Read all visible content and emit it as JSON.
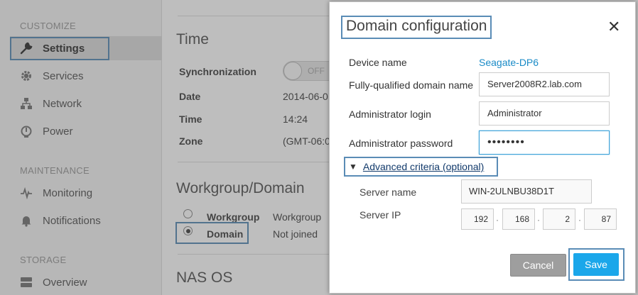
{
  "sidebar": {
    "sections": [
      {
        "title": "CUSTOMIZE"
      },
      {
        "title": "MAINTENANCE"
      },
      {
        "title": "STORAGE"
      }
    ],
    "items": [
      {
        "label": "Settings",
        "icon": "wrench-icon",
        "active": true
      },
      {
        "label": "Services",
        "icon": "gear-icon"
      },
      {
        "label": "Network",
        "icon": "network-icon"
      },
      {
        "label": "Power",
        "icon": "power-icon"
      },
      {
        "label": "Monitoring",
        "icon": "pulse-icon"
      },
      {
        "label": "Notifications",
        "icon": "bell-icon"
      },
      {
        "label": "Overview",
        "icon": "storage-icon"
      }
    ]
  },
  "main": {
    "time": {
      "title": "Time",
      "sync_label": "Synchronization",
      "sync_toggle": "OFF",
      "date_label": "Date",
      "date_value": "2014-06-0",
      "time_label": "Time",
      "time_value": "14:24",
      "zone_label": "Zone",
      "zone_value": "(GMT-06:0"
    },
    "workgroup": {
      "title": "Workgroup/Domain",
      "options": [
        {
          "label": "Workgroup",
          "value": "Workgroup",
          "selected": false
        },
        {
          "label": "Domain",
          "value": "Not joined",
          "selected": true
        }
      ]
    },
    "nas_title": "NAS OS"
  },
  "modal": {
    "title": "Domain configuration",
    "close": "✕",
    "device_name_label": "Device name",
    "device_name_value": "Seagate-DP6",
    "fqdn_label": "Fully-qualified domain name",
    "fqdn_value": "Server2008R2.lab.com",
    "admin_login_label": "Administrator login",
    "admin_login_value": "Administrator",
    "admin_password_label": "Administrator password",
    "admin_password_value": "••••••••",
    "advanced_toggle": "▼",
    "advanced_label": "Advanced criteria (optional)",
    "server_name_label": "Server name",
    "server_name_value": "WIN-2ULNBU38D1T",
    "server_ip_label": "Server IP",
    "server_ip": [
      "192",
      "168",
      "2",
      "87"
    ],
    "cancel_label": "Cancel",
    "save_label": "Save"
  },
  "colors": {
    "accent": "#1ba7ea",
    "highlight": "#5a8cb6",
    "link": "#1a8bc7"
  }
}
